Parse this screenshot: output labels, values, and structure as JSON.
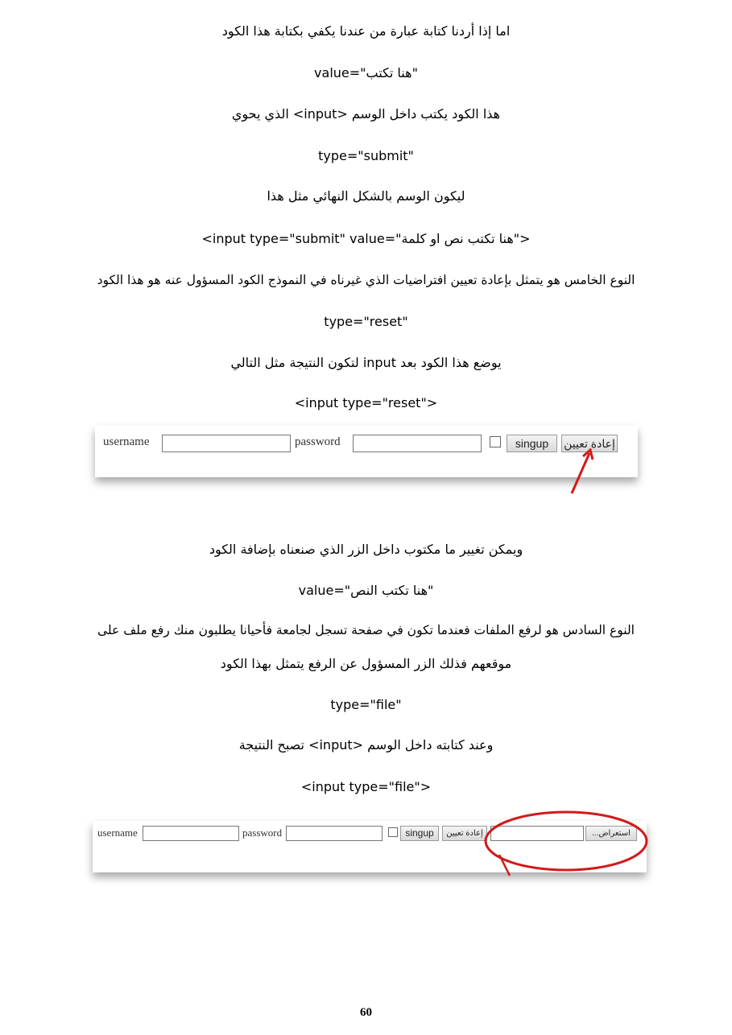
{
  "lines": [
    "اما إذا أردنا كتابة عبارة من عندنا يكفي بكتابة هذا الكود",
    "value=\"هنا تكتب\"",
    "هذا الكود يكتب داخل الوسم <input> الذي يحوي",
    "type=\"submit\"",
    "ليكون الوسم بالشكل النهائي مثل هذا",
    "<input type=\"submit\" value=\"هنا تكتب نص او كلمة\">",
    "النوع الخامس هو يتمثل بإعادة تعيين افتراضيات الذي غيرناه في النموذج الكود المسؤول عنه هو هذا الكود",
    "type=\"reset\"",
    "يوضع هذا الكود بعد input لتكون النتيجة مثل التالي",
    "<input type=\"reset\">",
    "ويمكن تغيير ما مكتوب داخل الزر الذي صنعناه بإضافة الكود",
    "value=\"هنا تكتب النص\"",
    "النوع السادس هو لرفع الملفات فعندما تكون في صفحة تسجل لجامعة فأحيانا يطلبون منك رفع ملف على",
    "موقعهم فذلك الزر المسؤول عن الرفع يتمثل بهذا الكود",
    "type=\"file\"",
    "وعند كتابته داخل الوسم <input> تصبح النتيجة",
    "<input type=\"file\">"
  ],
  "form1": {
    "username_label": "username",
    "password_label": "password",
    "signup_button": "singup",
    "reset_button": "إعادة تعيين"
  },
  "form2": {
    "username_label": "username",
    "password_label": "password",
    "signup_button": "singup",
    "reset_button": "إعادة تعيين",
    "browse_button": "استعراض..."
  },
  "page_number": "60",
  "colors": {
    "annotation": "#d11a1a",
    "text": "#000000"
  }
}
